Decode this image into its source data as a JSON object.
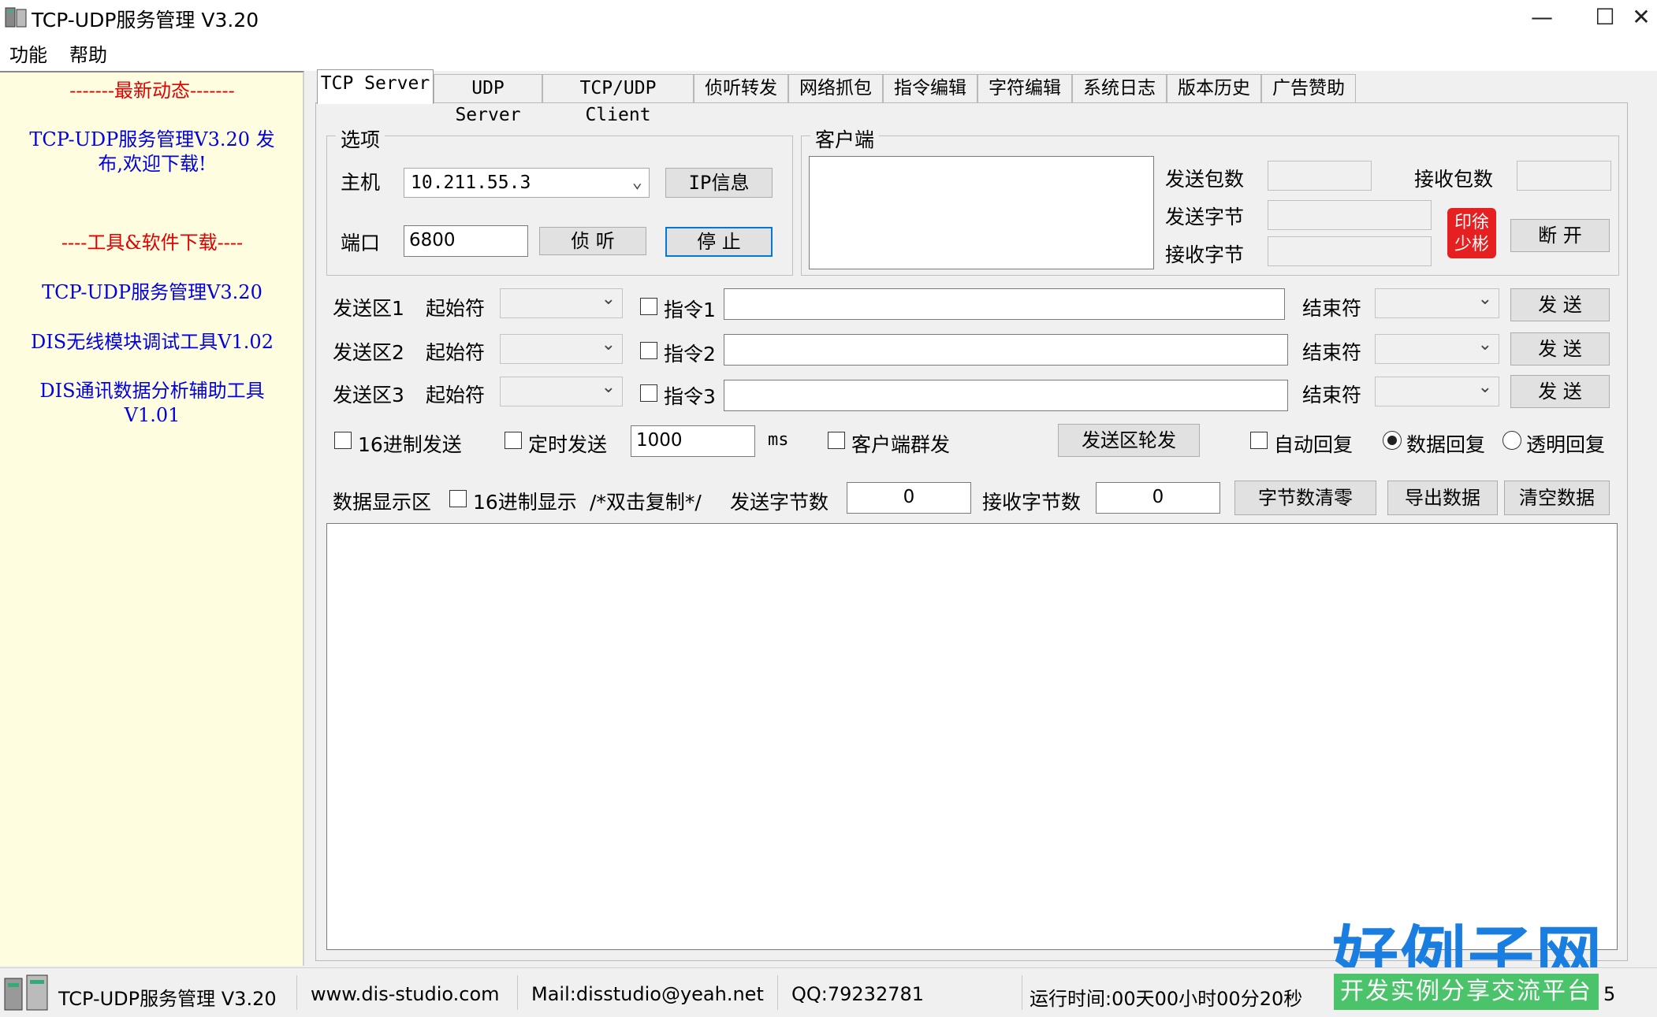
{
  "window": {
    "title": "TCP-UDP服务管理 V3.20",
    "minimize": "—",
    "maximize": "☐",
    "close": "✕"
  },
  "menu": {
    "items": [
      "功能",
      "帮助"
    ]
  },
  "sidebar": {
    "news_header": "-------最新动态-------",
    "news_line1": "TCP-UDP服务管理V3.20 发",
    "news_line2": "布,欢迎下载!",
    "tools_header": "----工具&软件下载----",
    "tool1": "TCP-UDP服务管理V3.20",
    "tool2": "DIS无线模块调试工具V1.02",
    "tool3_line1": "DIS通讯数据分析辅助工具",
    "tool3_line2": "V1.01"
  },
  "tabs": [
    "TCP Server",
    "UDP Server",
    "TCP/UDP Client",
    "侦听转发",
    "网络抓包",
    "指令编辑",
    "字符编辑",
    "系统日志",
    "版本历史",
    "广告赞助"
  ],
  "options": {
    "group_label": "选项",
    "host_label": "主机",
    "host_value": "10.211.55.3",
    "port_label": "端口",
    "port_value": "6800",
    "ip_info_button": "IP信息",
    "listen_button": "侦 听",
    "stop_button": "停 止"
  },
  "client": {
    "group_label": "客户端",
    "send_packets_label": "发送包数",
    "recv_packets_label": "接收包数",
    "send_bytes_label": "发送字节",
    "recv_bytes_label": "接收字节",
    "disconnect_button": "断 开",
    "seal_text": "印徐\n少彬"
  },
  "send_zones": [
    {
      "label": "发送区1",
      "start_label": "起始符",
      "cmd_label": "指令1",
      "end_label": "结束符",
      "send_button": "发 送"
    },
    {
      "label": "发送区2",
      "start_label": "起始符",
      "cmd_label": "指令2",
      "end_label": "结束符",
      "send_button": "发 送"
    },
    {
      "label": "发送区3",
      "start_label": "起始符",
      "cmd_label": "指令3",
      "end_label": "结束符",
      "send_button": "发 送"
    }
  ],
  "send_options": {
    "hex_send": "16进制发送",
    "timed_send": "定时发送",
    "interval": "1000",
    "ms": "ms",
    "client_broadcast": "客户端群发",
    "rotate_button": "发送区轮发",
    "auto_reply": "自动回复",
    "data_reply": "数据回复",
    "transparent_reply": "透明回复"
  },
  "display": {
    "label": "数据显示区",
    "hex_display": "16进制显示",
    "hint": "/*双击复制*/",
    "sent_bytes_label": "发送字节数",
    "sent_bytes": "0",
    "recv_bytes_label": "接收字节数",
    "recv_bytes": "0",
    "clear_count_button": "字节数清零",
    "export_button": "导出数据",
    "clear_button": "清空数据"
  },
  "status": {
    "app": "TCP-UDP服务管理 V3.20",
    "website": "www.dis-studio.com",
    "mail": "Mail:disstudio@yeah.net",
    "qq": "QQ:79232781",
    "runtime": "运行时间:00天00小时00分20秒",
    "extra": "5"
  },
  "watermark": {
    "main": "好例子网",
    "banner": "开发实例分享交流平台"
  },
  "colors": {
    "sidebar_bg": "#fffde0",
    "red_text": "#e00000",
    "blue_text": "#0000e0",
    "focus": "#0078d7"
  }
}
